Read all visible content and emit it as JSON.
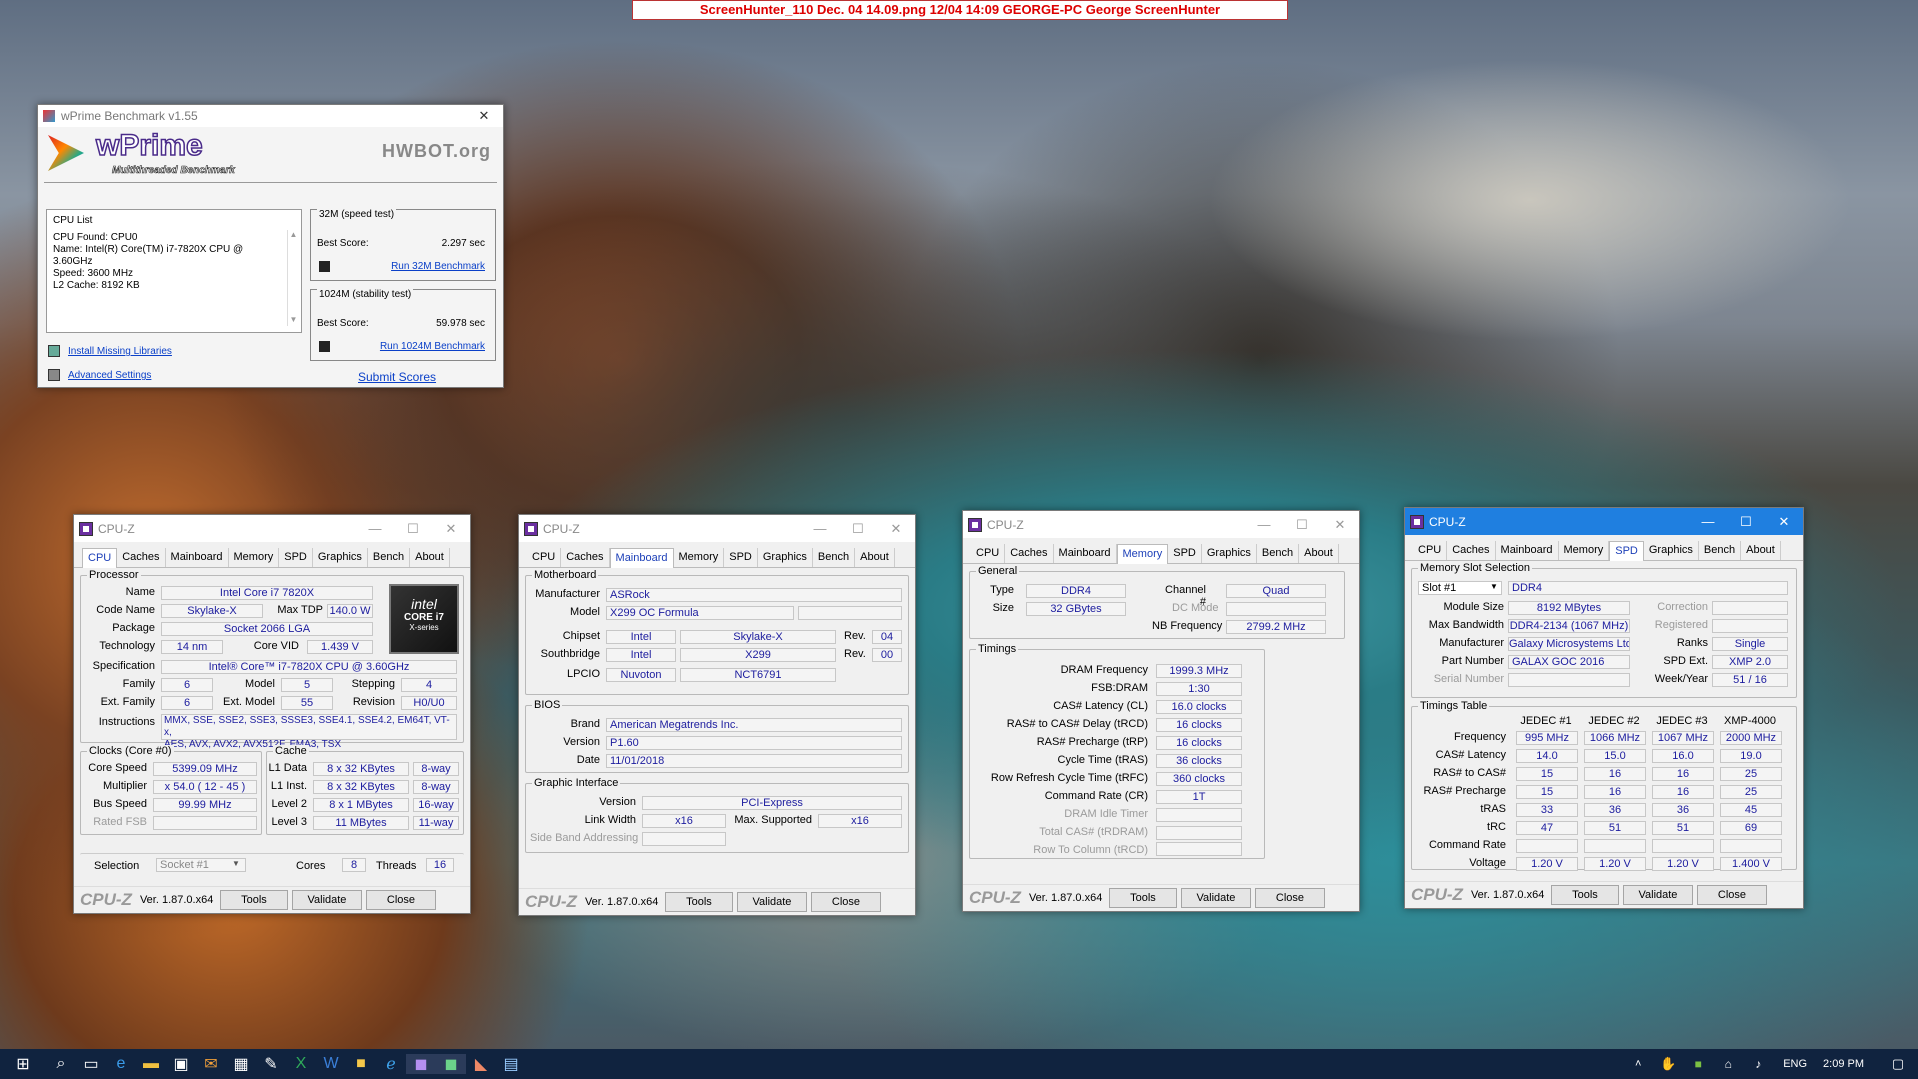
{
  "screenhunter": "ScreenHunter_110 Dec. 04 14.09.png  12/04  14:09  GEORGE-PC  George  ScreenHunter",
  "wprime": {
    "title": "wPrime Benchmark v1.55",
    "logo": "wPrime",
    "subtitle": "Multithreaded Benchmark",
    "hwbot": "HWBOT.org",
    "cpu_list_label": "CPU List",
    "cpu_lines": [
      "CPU Found: CPU0",
      "Name:    Intel(R) Core(TM) i7-7820X CPU @",
      "3.60GHz",
      "Speed:    3600 MHz",
      "L2 Cache: 8192 KB"
    ],
    "t32_label": "32M (speed test)",
    "t32_best_label": "Best Score:",
    "t32_best": "2.297 sec",
    "t32_run": "Run 32M Benchmark",
    "t1024_label": "1024M (stability test)",
    "t1024_best_label": "Best Score:",
    "t1024_best": "59.978 sec",
    "t1024_run": "Run 1024M Benchmark",
    "install": "Install Missing Libraries",
    "advanced": "Advanced Settings",
    "submit": "Submit Scores"
  },
  "cpuz_common": {
    "title": "CPU-Z",
    "logo": "CPU-Z",
    "version": "Ver. 1.87.0.x64",
    "tools": "Tools",
    "validate": "Validate",
    "close": "Close",
    "tabs": [
      "CPU",
      "Caches",
      "Mainboard",
      "Memory",
      "SPD",
      "Graphics",
      "Bench",
      "About"
    ]
  },
  "cpu": {
    "processor": "Processor",
    "name_l": "Name",
    "name": "Intel Core i7 7820X",
    "code_l": "Code Name",
    "code": "Skylake-X",
    "tdp_l": "Max TDP",
    "tdp": "140.0 W",
    "pkg_l": "Package",
    "pkg": "Socket 2066 LGA",
    "tech_l": "Technology",
    "tech": "14 nm",
    "vid_l": "Core VID",
    "vid": "1.439 V",
    "spec_l": "Specification",
    "spec": "Intel® Core™ i7-7820X CPU @ 3.60GHz",
    "fam_l": "Family",
    "fam": "6",
    "model_l": "Model",
    "model": "5",
    "step_l": "Stepping",
    "step": "4",
    "efam_l": "Ext. Family",
    "efam": "6",
    "emodel_l": "Ext. Model",
    "emodel": "55",
    "rev_l": "Revision",
    "rev": "H0/U0",
    "inst_l": "Instructions",
    "inst1": "MMX, SSE, SSE2, SSE3, SSSE3, SSE4.1, SSE4.2, EM64T, VT-x,",
    "inst2": "AES, AVX, AVX2, AVX512F, FMA3, TSX",
    "clocks": "Clocks (Core #0)",
    "cs_l": "Core Speed",
    "cs": "5399.09 MHz",
    "mul_l": "Multiplier",
    "mul": "x 54.0 ( 12 - 45 )",
    "bus_l": "Bus Speed",
    "bus": "99.99 MHz",
    "fsb_l": "Rated FSB",
    "cache": "Cache",
    "l1d_l": "L1 Data",
    "l1d": "8 x 32 KBytes",
    "l1d_w": "8-way",
    "l1i_l": "L1 Inst.",
    "l1i": "8 x 32 KBytes",
    "l1i_w": "8-way",
    "l2_l": "Level 2",
    "l2": "8 x 1 MBytes",
    "l2_w": "16-way",
    "l3_l": "Level 3",
    "l3": "11 MBytes",
    "l3_w": "11-way",
    "sel_l": "Selection",
    "sel": "Socket #1",
    "cores_l": "Cores",
    "cores": "8",
    "thr_l": "Threads",
    "thr": "16",
    "badge1": "intel",
    "badge2": "CORE i7",
    "badge3": "X-series"
  },
  "mb": {
    "mb": "Motherboard",
    "man_l": "Manufacturer",
    "man": "ASRock",
    "model_l": "Model",
    "model": "X299 OC Formula",
    "chip_l": "Chipset",
    "chip1": "Intel",
    "chip2": "Skylake-X",
    "rev_l": "Rev.",
    "chip_rev": "04",
    "sb_l": "Southbridge",
    "sb1": "Intel",
    "sb2": "X299",
    "sb_rev": "00",
    "lpc_l": "LPCIO",
    "lpc1": "Nuvoton",
    "lpc2": "NCT6791",
    "bios": "BIOS",
    "brand_l": "Brand",
    "brand": "American Megatrends Inc.",
    "bver_l": "Version",
    "bver": "P1.60",
    "date_l": "Date",
    "date": "11/01/2018",
    "gi": "Graphic Interface",
    "gver_l": "Version",
    "gver": "PCI-Express",
    "lw_l": "Link Width",
    "lw": "x16",
    "ms_l": "Max. Supported",
    "ms": "x16",
    "sba_l": "Side Band Addressing"
  },
  "mem": {
    "general": "General",
    "type_l": "Type",
    "type": "DDR4",
    "ch_l": "Channel #",
    "ch": "Quad",
    "size_l": "Size",
    "size": "32 GBytes",
    "dc_l": "DC Mode",
    "nb_l": "NB Frequency",
    "nb": "2799.2 MHz",
    "timings": "Timings",
    "df_l": "DRAM Frequency",
    "df": "1999.3 MHz",
    "fsb_l": "FSB:DRAM",
    "fsb": "1:30",
    "cl_l": "CAS# Latency (CL)",
    "cl": "16.0 clocks",
    "rcd_l": "RAS# to CAS# Delay (tRCD)",
    "rcd": "16 clocks",
    "rp_l": "RAS# Precharge (tRP)",
    "rp": "16 clocks",
    "ras_l": "Cycle Time (tRAS)",
    "ras": "36 clocks",
    "rfc_l": "Row Refresh Cycle Time (tRFC)",
    "rfc": "360 clocks",
    "cr_l": "Command Rate (CR)",
    "cr": "1T",
    "idle_l": "DRAM Idle Timer",
    "tcas_l": "Total CAS# (tRDRAM)",
    "rtc_l": "Row To Column (tRCD)"
  },
  "spd": {
    "sel": "Memory Slot Selection",
    "slot": "Slot #1",
    "ddr": "DDR4",
    "msize_l": "Module Size",
    "msize": "8192 MBytes",
    "corr_l": "Correction",
    "bw_l": "Max Bandwidth",
    "bw": "DDR4-2134 (1067 MHz)",
    "reg_l": "Registered",
    "man_l": "Manufacturer",
    "man": "Galaxy Microsystems Ltd.",
    "ranks_l": "Ranks",
    "ranks": "Single",
    "pn_l": "Part Number",
    "pn": "GALAX GOC 2016",
    "ext_l": "SPD Ext.",
    "ext": "XMP 2.0",
    "sn_l": "Serial Number",
    "wy_l": "Week/Year",
    "wy": "51 / 16",
    "tt": "Timings Table",
    "cols": [
      "JEDEC #1",
      "JEDEC #2",
      "JEDEC #3",
      "XMP-4000"
    ],
    "rows": [
      {
        "label": "Frequency",
        "vals": [
          "995 MHz",
          "1066 MHz",
          "1067 MHz",
          "2000 MHz"
        ]
      },
      {
        "label": "CAS# Latency",
        "vals": [
          "14.0",
          "15.0",
          "16.0",
          "19.0"
        ]
      },
      {
        "label": "RAS# to CAS#",
        "vals": [
          "15",
          "16",
          "16",
          "25"
        ]
      },
      {
        "label": "RAS# Precharge",
        "vals": [
          "15",
          "16",
          "16",
          "25"
        ]
      },
      {
        "label": "tRAS",
        "vals": [
          "33",
          "36",
          "36",
          "45"
        ]
      },
      {
        "label": "tRC",
        "vals": [
          "47",
          "51",
          "51",
          "69"
        ]
      },
      {
        "label": "Command Rate",
        "vals": [
          "",
          "",
          "",
          ""
        ]
      },
      {
        "label": "Voltage",
        "vals": [
          "1.20 V",
          "1.20 V",
          "1.20 V",
          "1.400 V"
        ]
      }
    ]
  },
  "taskbar": {
    "lang": "ENG",
    "time": "2:09 PM"
  },
  "icons": [
    "windows-icon",
    "search-icon",
    "task-view-icon",
    "edge-icon",
    "explorer-icon",
    "store-icon",
    "mail-icon",
    "calculator-icon",
    "paint-icon",
    "excel-icon",
    "word-icon",
    "notes-icon",
    "ie-icon",
    "cpuz-icon",
    "cpuz2-icon",
    "wprime-icon",
    "hunter-icon"
  ]
}
